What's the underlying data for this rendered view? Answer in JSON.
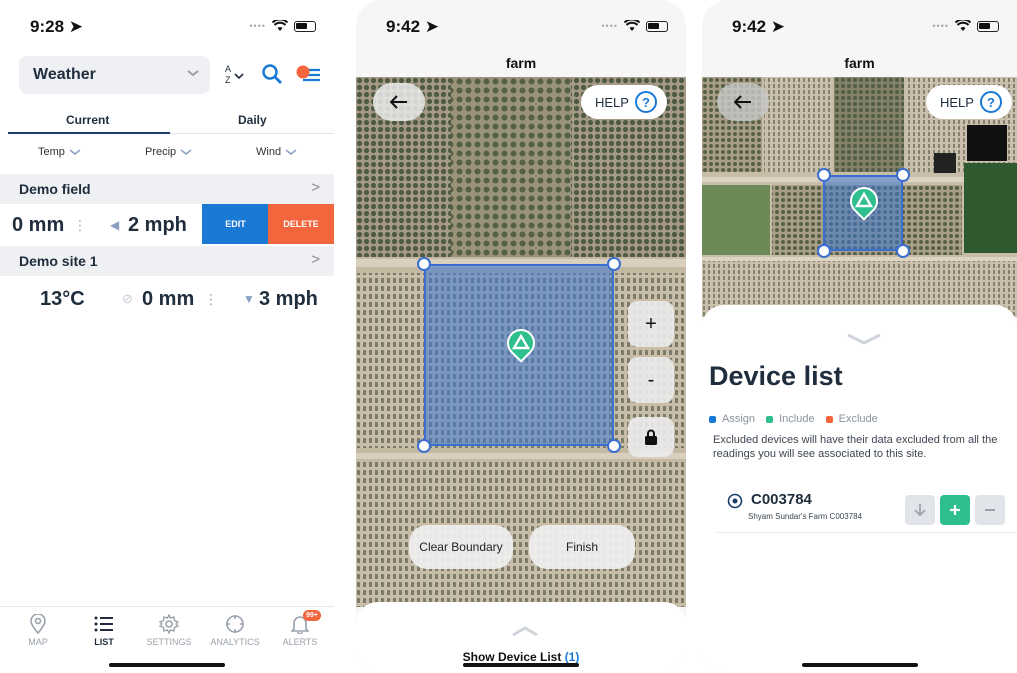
{
  "colors": {
    "accent": "#1a79d4",
    "danger": "#f3663d",
    "include": "#2fbf8f",
    "boundary": "#3a6fd0",
    "text": "#1f2d3d"
  },
  "panel1": {
    "time": "9:28",
    "weather_label": "Weather",
    "tabs": [
      {
        "label": "Current"
      },
      {
        "label": "Daily"
      }
    ],
    "filters": [
      {
        "label": "Temp"
      },
      {
        "label": "Precip"
      },
      {
        "label": "Wind"
      }
    ],
    "groups": [
      {
        "name": "Demo field",
        "precip": "0 mm",
        "wind": "2 mph"
      },
      {
        "name": "Demo site 1",
        "temp": "13°C",
        "precip": "0 mm",
        "wind": "3 mph"
      }
    ],
    "edit_label": "EDIT",
    "delete_label": "DELETE",
    "nav": [
      {
        "label": "MAP",
        "icon": "map-pin-icon"
      },
      {
        "label": "LIST",
        "icon": "list-icon"
      },
      {
        "label": "SETTINGS",
        "icon": "gear-icon"
      },
      {
        "label": "ANALYTICS",
        "icon": "crosshair-icon"
      },
      {
        "label": "ALERTS",
        "icon": "bell-icon",
        "badge": "99+"
      }
    ]
  },
  "panel2": {
    "time": "9:42",
    "title": "farm",
    "help_label": "HELP",
    "zoom_in": "+",
    "zoom_out": "-",
    "clear_label": "Clear Boundary",
    "finish_label": "Finish",
    "show_device_label": "Show Device List",
    "device_count": "(1)"
  },
  "panel3": {
    "time": "9:42",
    "title": "farm",
    "help_label": "HELP",
    "heading": "Device list",
    "legend": [
      {
        "label": "Assign",
        "color": "#1a79d4"
      },
      {
        "label": "Include",
        "color": "#2fbf8f"
      },
      {
        "label": "Exclude",
        "color": "#f3663d"
      }
    ],
    "description": "Excluded devices will have their data excluded from all the readings you will see associated to this site.",
    "device": {
      "id": "C003784",
      "subtitle": "Shyam Sundar's Farm C003784"
    }
  }
}
